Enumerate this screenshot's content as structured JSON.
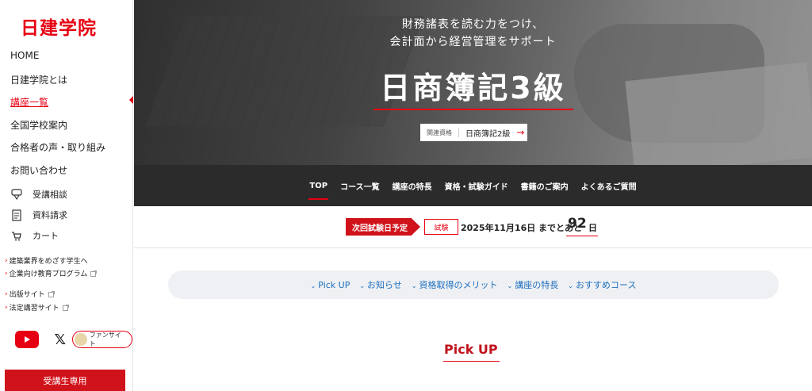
{
  "brand": {
    "logo": "日建学院",
    "accent": "#e60012"
  },
  "sidebar": {
    "nav": [
      {
        "label": "HOME"
      },
      {
        "label": "日建学院とは"
      },
      {
        "label": "講座一覧",
        "active": true
      },
      {
        "label": "全国学校案内"
      },
      {
        "label": "合格者の声・取り組み"
      },
      {
        "label": "お問い合わせ"
      }
    ],
    "utils": [
      {
        "label": "受講相談",
        "icon": "consult-icon"
      },
      {
        "label": "資料請求",
        "icon": "document-icon"
      },
      {
        "label": "カート",
        "icon": "cart-icon"
      }
    ],
    "sub_links": [
      {
        "label": "建築業界をめざす学生へ"
      },
      {
        "label": "企業向け教育プログラム",
        "external": true
      },
      {
        "label": "出版サイト",
        "external": true
      },
      {
        "label": "法定講習サイト",
        "external": true
      }
    ],
    "social": {
      "fan_label": "ファンサイト"
    },
    "student_button": "受講生専用"
  },
  "hero": {
    "subtitle_line1": "財務諸表を読む力をつけ、",
    "subtitle_line2": "会計面から経営管理をサポート",
    "title": "日商簿記3級",
    "related_label": "関連資格",
    "related_value": "日商簿記2級",
    "related_arrow": "→"
  },
  "tabs": [
    {
      "label": "TOP",
      "active": true
    },
    {
      "label": "コース一覧"
    },
    {
      "label": "講座の特長"
    },
    {
      "label": "資格・試験ガイド"
    },
    {
      "label": "書籍のご案内"
    },
    {
      "label": "よくあるご質問"
    }
  ],
  "countdown": {
    "next_label": "次回試験日予定",
    "exam_tag": "試験",
    "date_text": "2025年11月16日 までとあと",
    "days": "92",
    "days_unit": "日"
  },
  "anchors": [
    {
      "label": "Pick UP"
    },
    {
      "label": "お知らせ"
    },
    {
      "label": "資格取得のメリット"
    },
    {
      "label": "講座の特長"
    },
    {
      "label": "おすすめコース"
    }
  ],
  "section": {
    "pick_up_title": "Pick UP"
  }
}
